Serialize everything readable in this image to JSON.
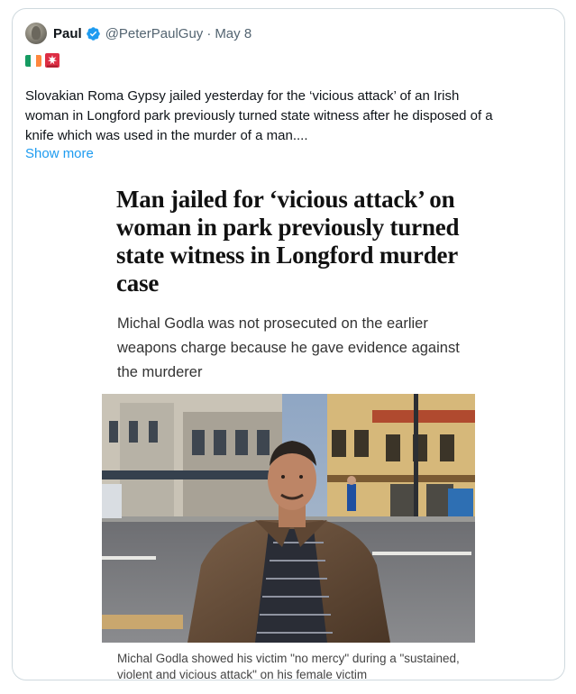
{
  "tweet": {
    "author_name": "Paul",
    "author_handle": "@PeterPaulGuy",
    "separator": "·",
    "date": "May 8",
    "text": "Slovakian Roma Gypsy jailed yesterday for the ‘vicious attack’ of an   Irish\nwoman in Longford park previously turned state witness after he disposed of a\nknife which was used in the murder of a man....",
    "show_more_label": "Show more",
    "emojis": [
      "flag-ireland-icon",
      "police-siren-icon"
    ]
  },
  "article": {
    "title": "Man jailed for ‘vicious attack’ on woman in park previously turned state witness in Longford murder case",
    "subtitle": "Michal Godla was not prosecuted on the earlier weapons charge because he gave evidence against the murderer",
    "caption": "Michal Godla showed his victim \"no mercy\" during a \"sustained, violent and vicious attack\" on his female victim"
  },
  "colors": {
    "link": "#1d9bf0",
    "verified": "#1d9bf0",
    "muted": "#536471",
    "border": "#cfd9de"
  }
}
